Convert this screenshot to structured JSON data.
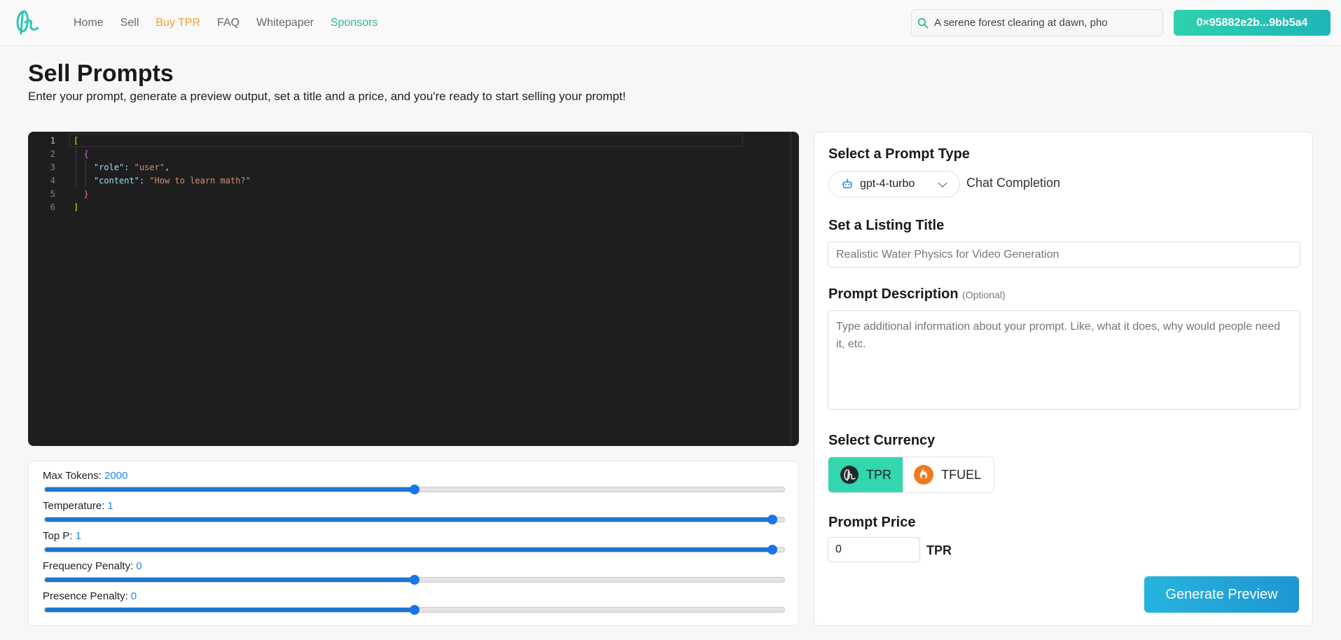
{
  "nav": {
    "links": [
      "Home",
      "Sell",
      "Buy TPR",
      "FAQ",
      "Whitepaper",
      "Sponsors"
    ],
    "search_value": "A serene forest clearing at dawn, pho",
    "wallet": "0×95882e2b...9bb5a4"
  },
  "page": {
    "title": "Sell Prompts",
    "subtitle": "Enter your prompt, generate a preview output, set a title and a price, and you're ready to start selling your prompt!"
  },
  "editor": {
    "line_numbers": [
      "1",
      "2",
      "3",
      "4",
      "5",
      "6"
    ],
    "lines": [
      [
        {
          "t": "[",
          "c": "b1"
        }
      ],
      [
        {
          "t": "  "
        },
        {
          "t": "{",
          "c": "b2"
        }
      ],
      [
        {
          "t": "    "
        },
        {
          "t": "\"role\"",
          "c": "k"
        },
        {
          "t": ": "
        },
        {
          "t": "\"user\"",
          "c": "s"
        },
        {
          "t": ","
        }
      ],
      [
        {
          "t": "    "
        },
        {
          "t": "\"content\"",
          "c": "k"
        },
        {
          "t": ": "
        },
        {
          "t": "\"How to learn math?\"",
          "c": "s"
        }
      ],
      [
        {
          "t": "  "
        },
        {
          "t": "}",
          "c": "b2"
        }
      ],
      [
        {
          "t": "]",
          "c": "b1"
        }
      ]
    ]
  },
  "params": [
    {
      "label": "Max Tokens:",
      "value": "2000",
      "fraction": 0.5
    },
    {
      "label": "Temperature:",
      "value": "1",
      "fraction": 0.984
    },
    {
      "label": "Top P:",
      "value": "1",
      "fraction": 0.984
    },
    {
      "label": "Frequency Penalty:",
      "value": "0",
      "fraction": 0.5
    },
    {
      "label": "Presence Penalty:",
      "value": "0",
      "fraction": 0.5
    }
  ],
  "form": {
    "prompt_type_title": "Select a Prompt Type",
    "model": "gpt-4-turbo",
    "model_type": "Chat Completion",
    "listing_title_label": "Set a Listing Title",
    "listing_title_value": "Realistic Water Physics for Video Generation",
    "description_label": "Prompt Description",
    "description_optional": "(Optional)",
    "description_placeholder": "Type additional information about your prompt. Like, what it does, why would people need it, etc.",
    "currency_label": "Select Currency",
    "currencies": [
      "TPR",
      "TFUEL"
    ],
    "selected_currency": "TPR",
    "price_label": "Prompt Price",
    "price_value": "0",
    "price_unit": "TPR",
    "generate_button": "Generate Preview"
  },
  "colors": {
    "accent_teal": "#33d6ae",
    "button_blue": "#1e96d2",
    "slider_blue": "#1976d2",
    "nav_orange": "#f0a030",
    "nav_teal": "#2fb89a"
  },
  "icons": {
    "search": "search-icon",
    "robot": "robot-icon",
    "chevron": "chevron-down-icon",
    "tpr_coin": "tpr-coin-icon",
    "tfuel_coin": "tfuel-coin-icon"
  }
}
